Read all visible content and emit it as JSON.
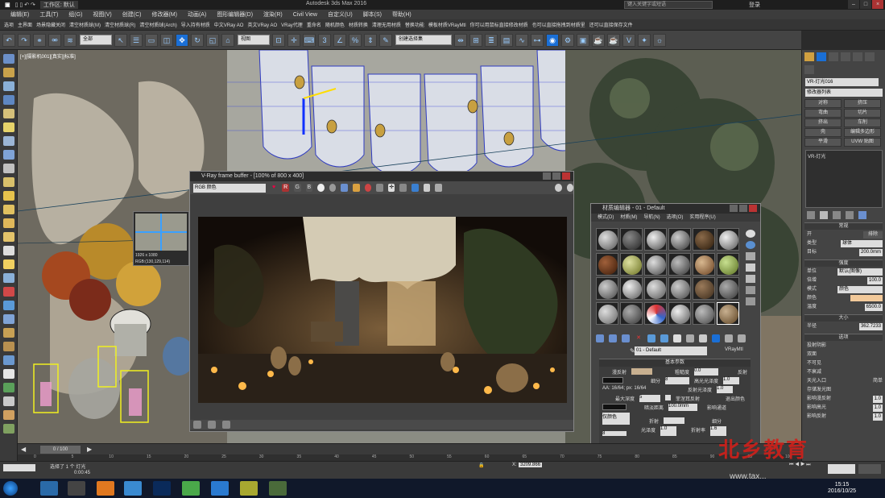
{
  "titlebar": {
    "workspace": "工作区: 默认",
    "title": "Autodesk 3ds Max 2016",
    "search_placeholder": "键入关键字或短语",
    "user": "登录"
  },
  "menus": [
    "编辑(E)",
    "工具(T)",
    "组(G)",
    "视图(V)",
    "创建(C)",
    "修改器(M)",
    "动画(A)",
    "图形编辑器(D)",
    "渲染(R)",
    "Civil View",
    "自定义(U)",
    "脚本(S)",
    "帮助(H)"
  ],
  "plugins": [
    "选项",
    "主界面",
    "场景隐藏关闭",
    "清空材质球(M)",
    "清空材质球(R)",
    "清空材质球(Arch)",
    "导入持有材质",
    "中文VRay AO",
    "英文VRay AO",
    "VRay代理",
    "重命名",
    "随机颜色",
    "材质转换",
    "清理无用材质",
    "替换功能",
    "模板材质VRayMtl",
    "你可以用鼠标直接修改材质",
    "也可以直接拖拽到材质里",
    "还可以直接保存文件"
  ],
  "toolbar": {
    "selection_filter": "全部",
    "refcoord": "视图",
    "named_sel": "创建选择集"
  },
  "viewport": {
    "label": "[+][摄影机001][真实][标准]",
    "color_picker": {
      "size": "1926 x 1080",
      "rgb": "RGB:(130,129,114)"
    }
  },
  "vfb": {
    "title": "V-Ray frame buffer - [100% of 800 x 400]",
    "channel": "RGB 颜色",
    "buttons": [
      "R",
      "G",
      "B"
    ]
  },
  "mated": {
    "title": "材质编辑器 - 01 - Default",
    "menus": [
      "模式(D)",
      "材质(M)",
      "导航(N)",
      "选项(O)",
      "实用程序(U)"
    ],
    "name": "01 - Default",
    "type": "VRayMtl",
    "rollout": "基本参数",
    "params": [
      {
        "label": "漫反射",
        "value": ""
      },
      {
        "label": "粗糙度",
        "value": "0.0"
      },
      {
        "label": "反射",
        "value": ""
      },
      {
        "label": "细分",
        "value": "8"
      },
      {
        "label": "高光光泽度",
        "value": "1.0"
      },
      {
        "label": "反射光泽度",
        "value": "1.0"
      },
      {
        "label": "最大深度",
        "value": "5"
      },
      {
        "label": "菲涅耳反射",
        "value": ""
      },
      {
        "label": "退出颜色",
        "value": ""
      },
      {
        "label": "暗淡距离",
        "value": "100.0mm"
      },
      {
        "label": "影响通道",
        "value": "仅颜色"
      },
      {
        "label": "折射",
        "value": ""
      },
      {
        "label": "细分",
        "value": "8"
      },
      {
        "label": "光泽度",
        "value": "1.0"
      },
      {
        "label": "折射率",
        "value": "1.6"
      }
    ],
    "subdiv_info": "AA: 16/64; px: 16/64"
  },
  "cmdpanel": {
    "object_name": "VR-灯光016",
    "modifier_list": "修改器列表",
    "buttons": [
      "对称",
      "挤压",
      "弯曲",
      "切片",
      "挤出",
      "车削",
      "壳",
      "编辑多边形",
      "平滑",
      "UVW 贴图"
    ],
    "stack_item": "VR-灯光",
    "rollouts": {
      "general": "常规",
      "on_label": "开",
      "exclude": "排除",
      "type_label": "类型",
      "type_value": "球体",
      "target_label": "目标",
      "target_value": "200.0mm",
      "intensity": "强度",
      "units_label": "单位",
      "units_value": "默认(图像)",
      "multiplier_label": "倍增",
      "multiplier_value": "100.0",
      "mode_label": "模式",
      "mode_value": "颜色",
      "color_label": "颜色",
      "temp_label": "温度",
      "temp_value": "6500.0",
      "size": "大小",
      "radius_label": "半径",
      "radius_value": "362.7233",
      "options": "选项",
      "checks": [
        "投射阴影",
        "双面",
        "不可见",
        "不衰减",
        "天光入口",
        "简单",
        "存储发光图",
        "影响漫反射",
        "影响高光",
        "影响反射"
      ],
      "check_vals": [
        "1.0",
        "1.0",
        "1.0"
      ]
    }
  },
  "timeline": {
    "slider": "0 / 100",
    "ticks": [
      "0",
      "5",
      "10",
      "15",
      "20",
      "25",
      "30",
      "35",
      "40",
      "45",
      "50",
      "55",
      "60",
      "65",
      "70",
      "75",
      "80",
      "85",
      "90",
      "95",
      "100"
    ]
  },
  "status": {
    "selected": "选择了 1 个 灯光",
    "time": "0:00:45",
    "x_label": "X:",
    "x_value": "3209.866"
  },
  "taskbar": {
    "time": "15:15",
    "date": "2016/10/25"
  },
  "watermark": {
    "text": "北乡教育",
    "url": "www.tax..."
  },
  "colors": {
    "accent": "#1a6fd6",
    "watermark": "#d0201a"
  }
}
